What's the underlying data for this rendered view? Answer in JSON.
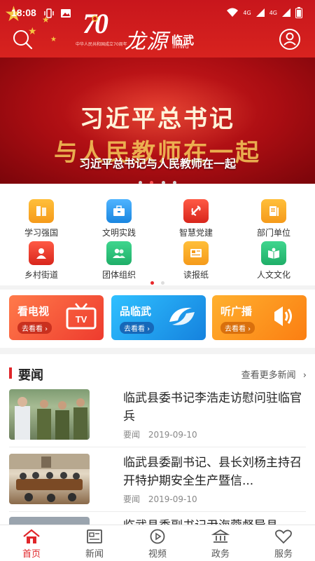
{
  "status_bar": {
    "time": "18:08",
    "network_labels": [
      "4G",
      "4G"
    ]
  },
  "header": {
    "emblem_number": "70",
    "emblem_caption": "中华人民共和国成立70周年",
    "brand_calligraphy": "龙源",
    "brand_city": "临武",
    "brand_pinyin": "linwu"
  },
  "banner": {
    "line1": "习近平总书记",
    "line2": "与人民教师在一起",
    "caption": "习近平总书记与人民教师在一起",
    "slide_count": 4,
    "active_slide": 2
  },
  "grid": {
    "items": [
      {
        "label": "学习强国",
        "icon": "book-icon",
        "color": "#f5a623"
      },
      {
        "label": "文明实践",
        "icon": "briefcase-icon",
        "color": "#2e9df0"
      },
      {
        "label": "智慧党建",
        "icon": "party-emblem-icon",
        "color": "#e8392c"
      },
      {
        "label": "部门单位",
        "icon": "document-icon",
        "color": "#f5a623"
      },
      {
        "label": "乡村街道",
        "icon": "person-icon",
        "color": "#e8392c"
      },
      {
        "label": "团体组织",
        "icon": "group-icon",
        "color": "#2bbf7a"
      },
      {
        "label": "读报纸",
        "icon": "newspaper-icon",
        "color": "#f5a623"
      },
      {
        "label": "人文文化",
        "icon": "open-book-icon",
        "color": "#2bbf7a"
      }
    ],
    "page_count": 2,
    "active_page": 1
  },
  "media": [
    {
      "title": "看电视",
      "subtitle": "去看看 ›",
      "icon": "tv-icon",
      "color": "#f25a3c"
    },
    {
      "title": "品临武",
      "subtitle": "去看看 ›",
      "icon": "logo-swirl-icon",
      "color": "#1a9be8"
    },
    {
      "title": "听广播",
      "subtitle": "去看看 ›",
      "icon": "speaker-icon",
      "color": "#fb9a1a"
    }
  ],
  "news": {
    "section_title": "要闻",
    "more_label": "查看更多新闻",
    "items": [
      {
        "headline": "临武县委书记李浩走访慰问驻临官兵",
        "tag": "要闻",
        "date": "2019-09-10"
      },
      {
        "headline": "临武县委副书记、县长刘杨主持召开特护期安全生产暨信...",
        "tag": "要闻",
        "date": "2019-09-10"
      },
      {
        "headline": "临武县委副书记尹海蓉督导县"
      }
    ]
  },
  "bottom_nav": {
    "items": [
      {
        "label": "首页",
        "icon": "home-icon",
        "active": true
      },
      {
        "label": "新闻",
        "icon": "newspaper-icon",
        "active": false
      },
      {
        "label": "视频",
        "icon": "play-icon",
        "active": false
      },
      {
        "label": "政务",
        "icon": "government-building-icon",
        "active": false
      },
      {
        "label": "服务",
        "icon": "heart-icon",
        "active": false
      }
    ]
  },
  "colors": {
    "brand_red": "#d41f1f",
    "accent_red": "#e0262a",
    "gold": "#f4c542"
  }
}
